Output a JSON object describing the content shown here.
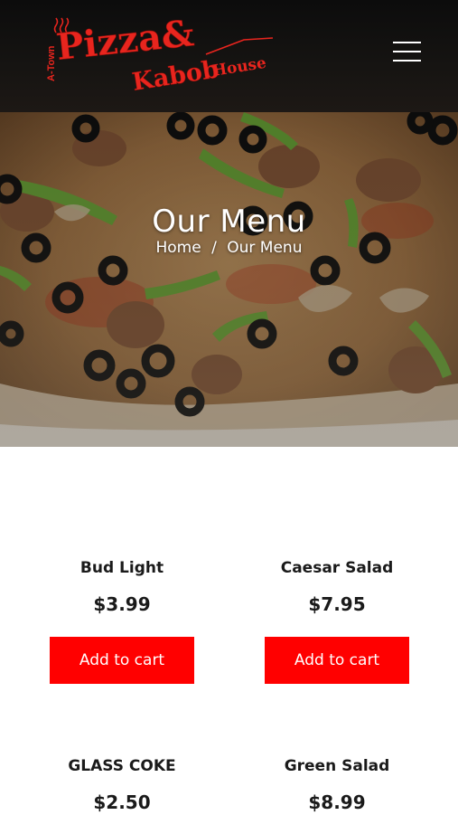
{
  "header": {
    "logo": {
      "line1": "Pizza&",
      "line2": "Kabob",
      "line3": "House",
      "tagline": "A-Town"
    },
    "menu_icon": "hamburger-menu-icon"
  },
  "hero": {
    "title": "Our Menu",
    "breadcrumb": {
      "home": "Home",
      "separator": "/",
      "current": "Our Menu"
    }
  },
  "products": [
    {
      "name": "Bud Light",
      "price": "$3.99",
      "button": "Add to cart"
    },
    {
      "name": "Caesar Salad",
      "price": "$7.95",
      "button": "Add to cart"
    },
    {
      "name": "GLASS COKE",
      "price": "$2.50"
    },
    {
      "name": "Green Salad",
      "price": "$8.99"
    }
  ],
  "colors": {
    "accent": "#ff0000",
    "logo_red": "#e8251e",
    "header_bg": "#121110",
    "text": "#1a1a1a"
  }
}
